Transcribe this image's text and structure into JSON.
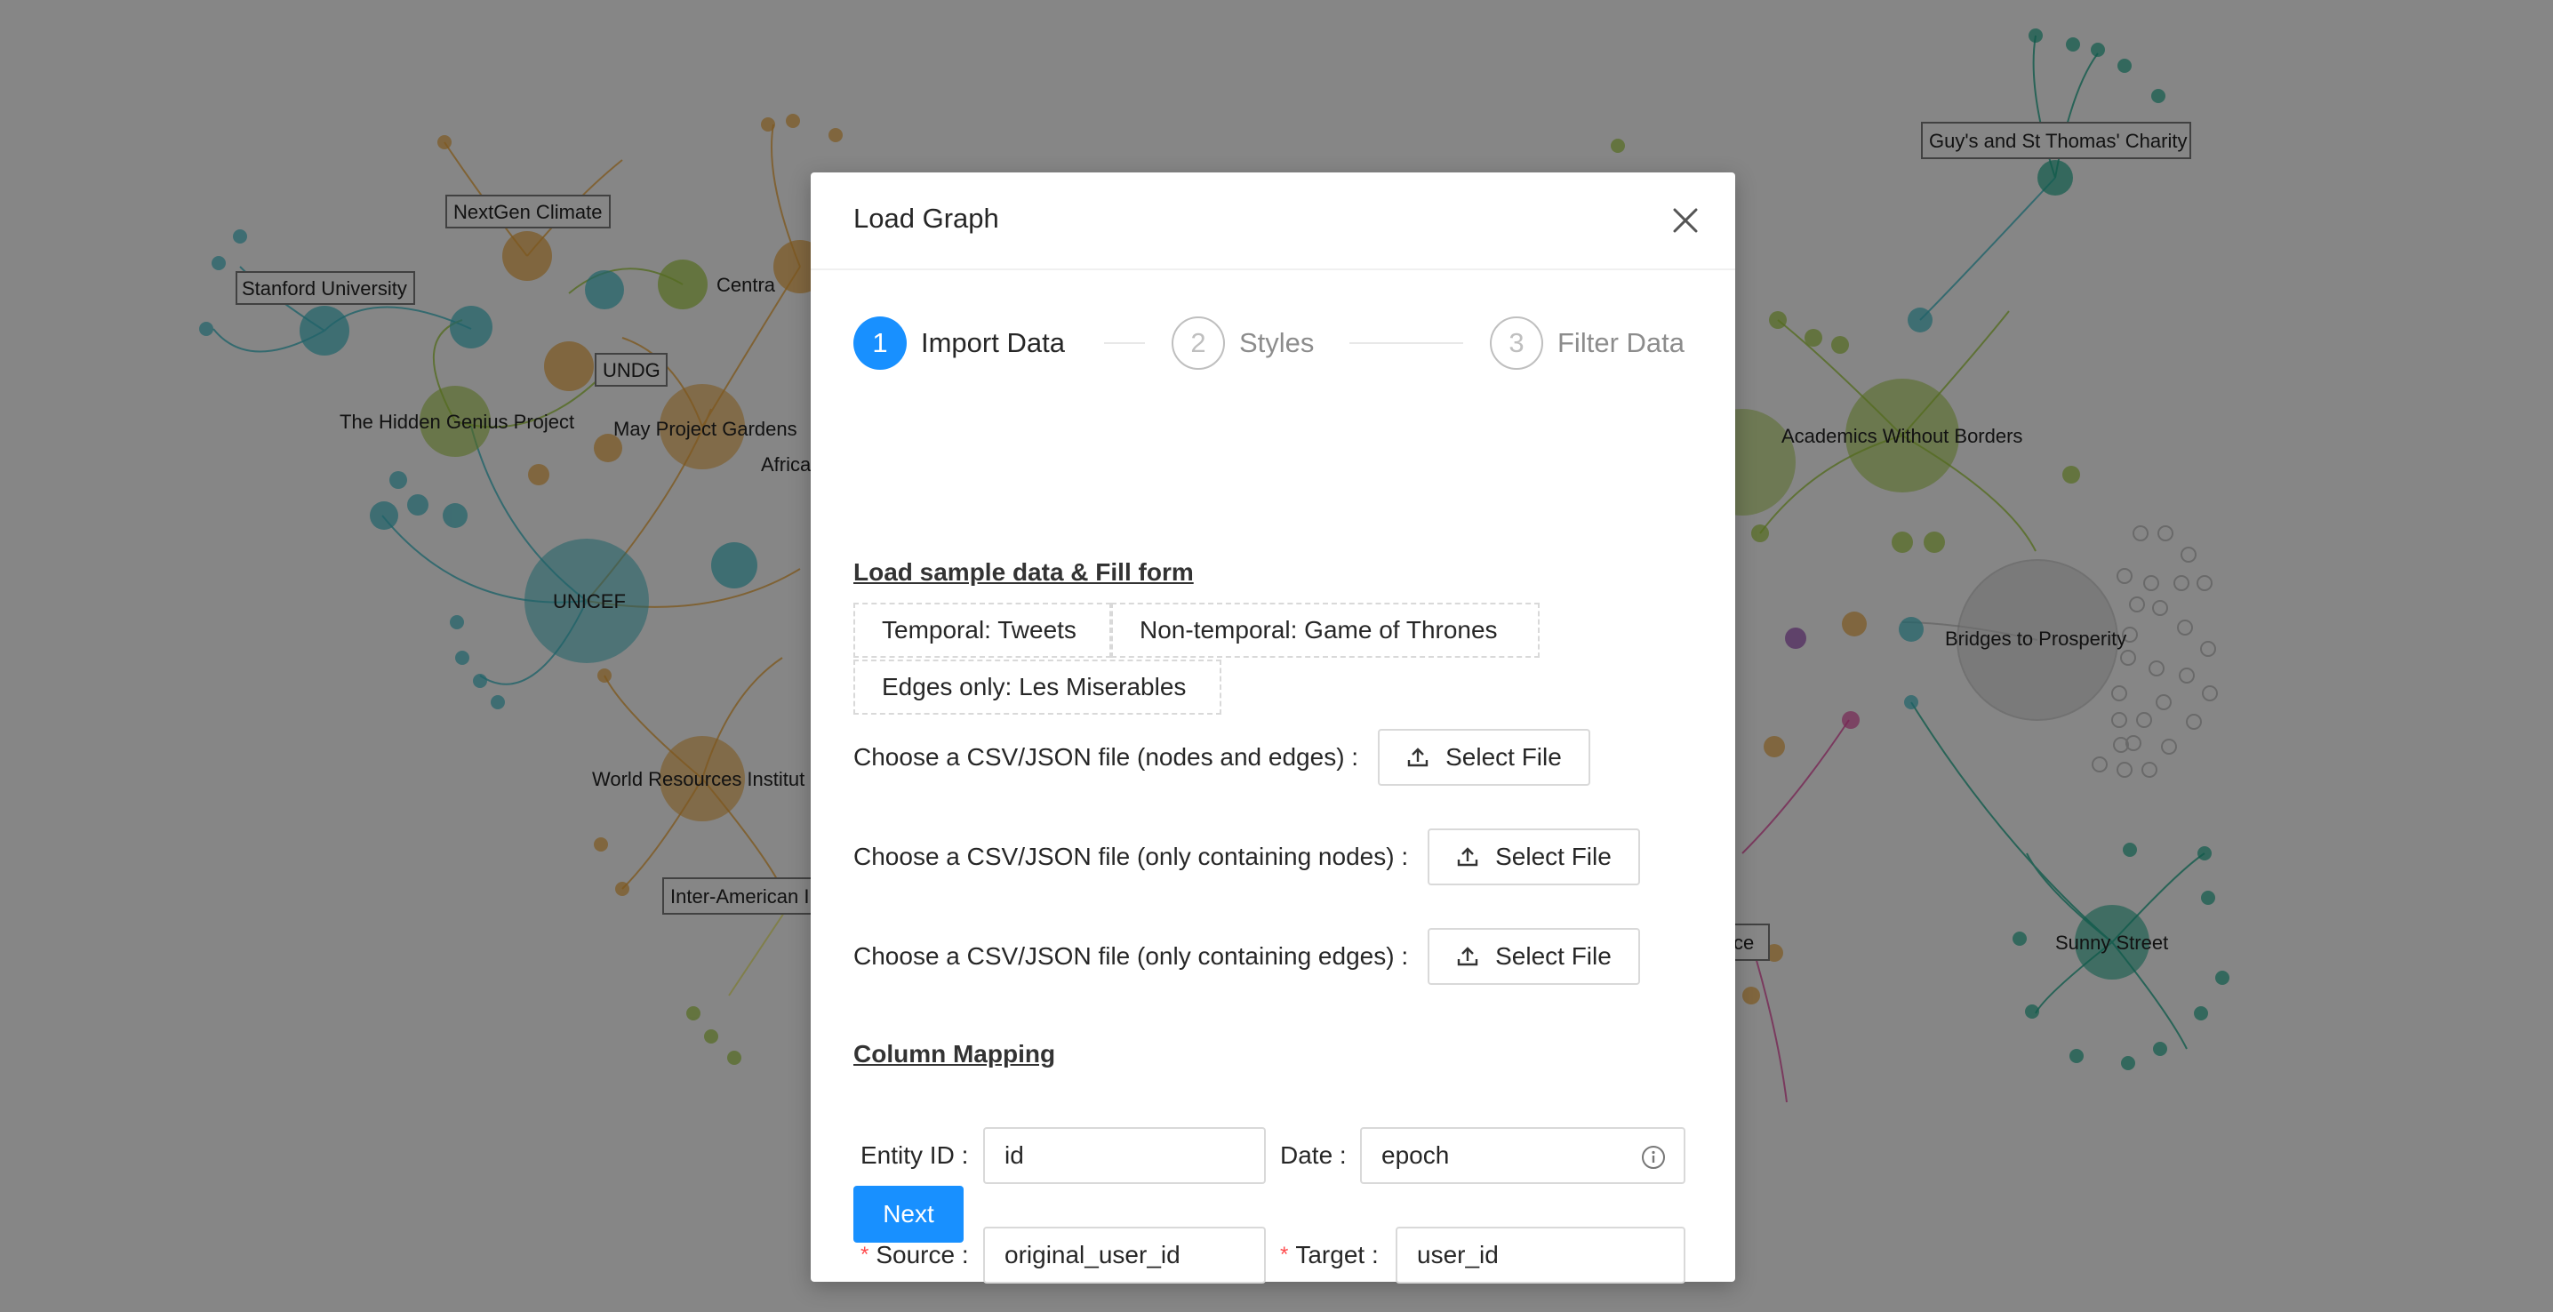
{
  "background_graph": {
    "labels": [
      "Stanford University",
      "NextGen Climate",
      "UNDG",
      "The Hidden Genius Project",
      "May Project Gardens",
      "Centra",
      "Africa",
      "UNICEF",
      "World Resources Institut",
      "Inter-American I",
      "Guy's and St Thomas' Charity",
      "Academics Without Borders",
      "Bridges to Prosperity",
      "Sunny Street",
      "ce"
    ]
  },
  "modal": {
    "title": "Load Graph",
    "close_icon": "close-icon",
    "steps": [
      {
        "number": "1",
        "label": "Import Data",
        "state": "active"
      },
      {
        "number": "2",
        "label": "Styles",
        "state": "wait"
      },
      {
        "number": "3",
        "label": "Filter Data",
        "state": "wait"
      }
    ],
    "sample_section": {
      "title": "Load sample data & Fill form",
      "buttons": [
        "Temporal: Tweets",
        "Non-temporal: Game of Thrones",
        "Edges only: Les Miserables"
      ]
    },
    "file_inputs": [
      {
        "label": "Choose a CSV/JSON file (nodes and edges) :",
        "button": "Select File"
      },
      {
        "label": "Choose a CSV/JSON file (only containing nodes) :",
        "button": "Select File"
      },
      {
        "label": "Choose a CSV/JSON file (only containing edges) :",
        "button": "Select File"
      }
    ],
    "column_mapping": {
      "title": "Column Mapping",
      "entity_id": {
        "label": "Entity ID :",
        "value": "id"
      },
      "date": {
        "label": "Date :",
        "value": "epoch"
      },
      "source": {
        "label": "Source :",
        "value": "original_user_id",
        "required_mark": "*"
      },
      "target": {
        "label": "Target :",
        "value": "user_id",
        "required_mark": "*"
      }
    },
    "next_button": "Next"
  },
  "colors": {
    "primary": "#1890ff",
    "mask": "rgba(0,0,0,0.45)",
    "required": "#ff4d4f"
  }
}
